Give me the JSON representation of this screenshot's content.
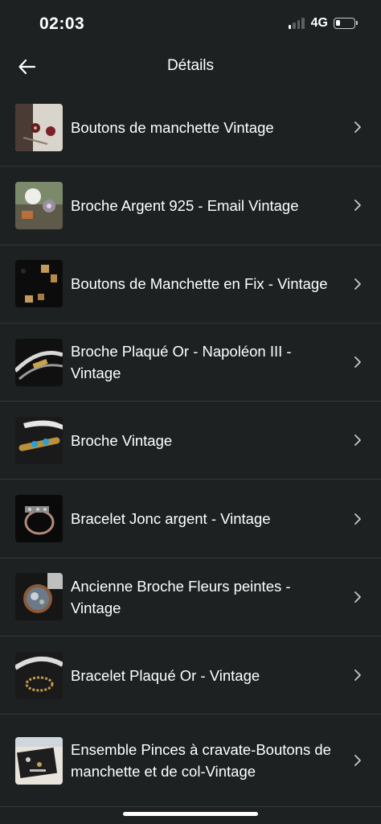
{
  "status_bar": {
    "time": "02:03",
    "network": "4G",
    "signal_bars": 4,
    "signal_active": 1,
    "battery_level": 0.2
  },
  "header": {
    "title": "Détails",
    "back_icon": "arrow-left-icon"
  },
  "items": [
    {
      "label": "Boutons de manchette Vintage"
    },
    {
      "label": "Broche Argent 925 - Email Vintage"
    },
    {
      "label": "Boutons de Manchette en Fix - Vintage"
    },
    {
      "label": "Broche Plaqué Or - Napoléon III - Vintage"
    },
    {
      "label": "Broche Vintage"
    },
    {
      "label": "Bracelet Jonc argent - Vintage"
    },
    {
      "label": "Ancienne Broche Fleurs peintes - Vintage"
    },
    {
      "label": "Bracelet Plaqué Or - Vintage"
    },
    {
      "label": "Ensemble Pinces à cravate-Boutons de manchette et de col-Vintage"
    }
  ],
  "chevron_icon": "chevron-right-icon"
}
